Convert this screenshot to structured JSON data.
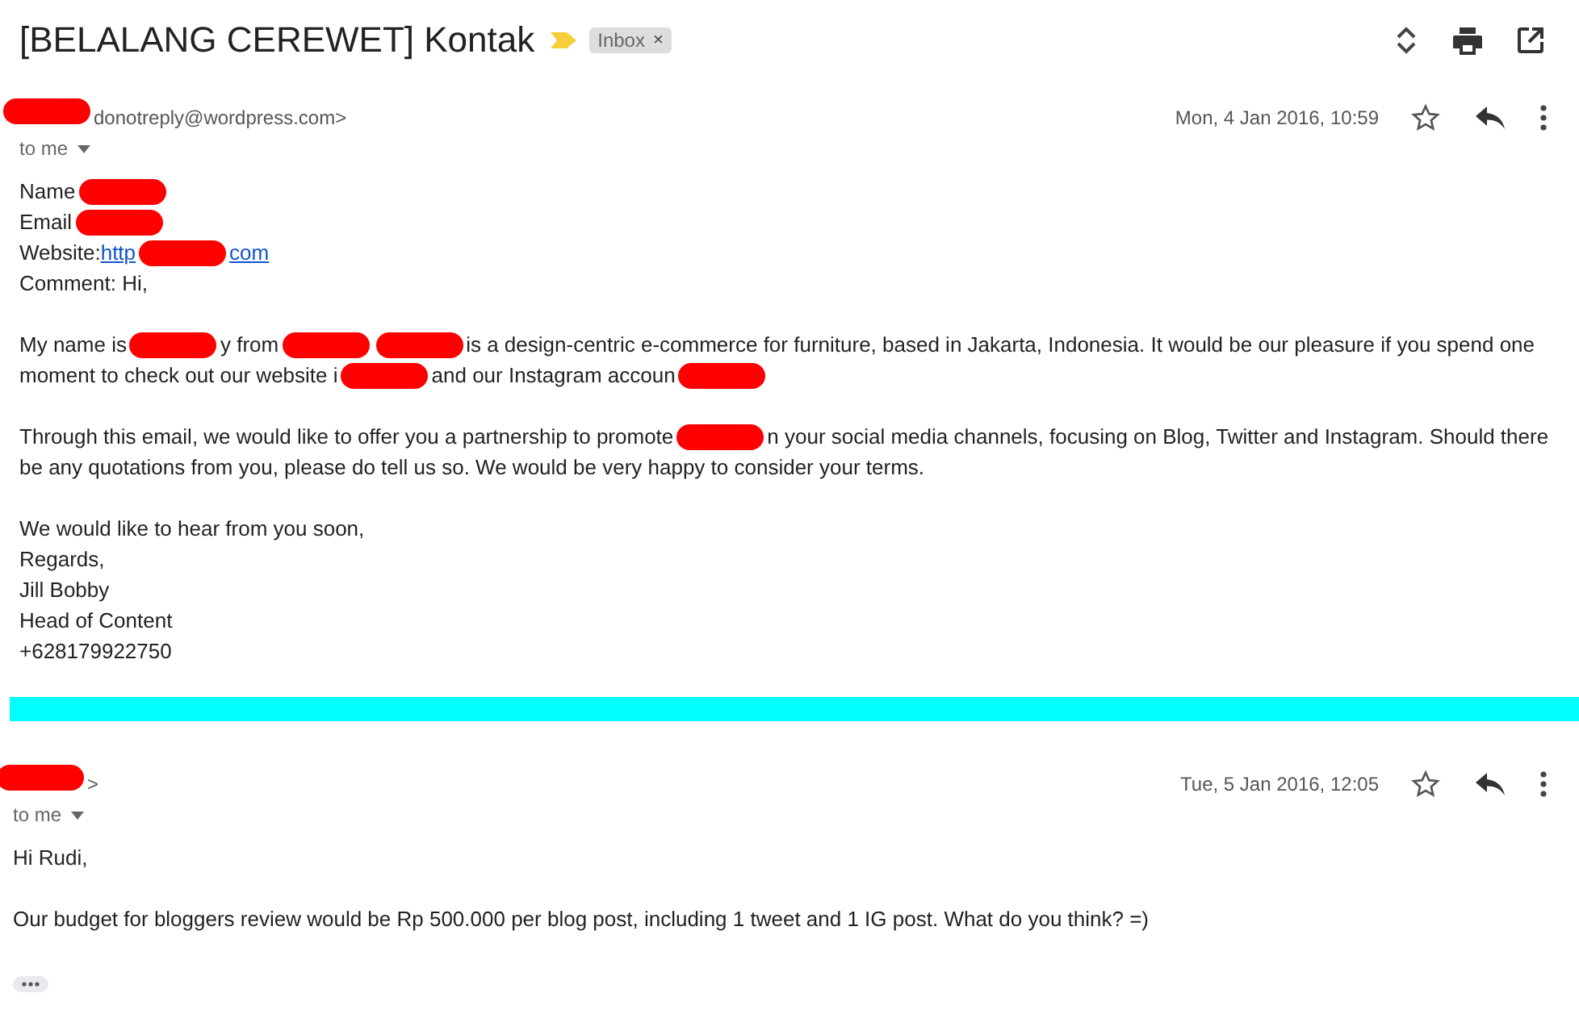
{
  "subject": "[BELALANG CEREWET] Kontak",
  "label": {
    "text": "Inbox",
    "remove": "×"
  },
  "messages": [
    {
      "sender": [
        {
          "kind": "redaction"
        },
        {
          "kind": "text",
          "text": "donotreply@wordpress.com>"
        }
      ],
      "recipient": "to me",
      "date": "Mon, 4 Jan 2016, 10:59",
      "paragraphs": [
        [
          [
            {
              "kind": "text",
              "text": "Name"
            },
            {
              "kind": "redaction"
            }
          ],
          [
            {
              "kind": "text",
              "text": "Email"
            },
            {
              "kind": "redaction"
            }
          ],
          [
            {
              "kind": "text",
              "text": "Website: "
            },
            {
              "kind": "link",
              "text": "http"
            },
            {
              "kind": "redaction"
            },
            {
              "kind": "link",
              "text": "com"
            }
          ],
          [
            {
              "kind": "text",
              "text": "Comment: Hi,"
            }
          ]
        ],
        [
          [
            {
              "kind": "text",
              "text": "My name is"
            },
            {
              "kind": "redaction"
            },
            {
              "kind": "text",
              "text": "y from"
            },
            {
              "kind": "redaction"
            },
            {
              "kind": "redaction"
            },
            {
              "kind": "text",
              "text": "is a design-centric e-commerce for furniture, based in Jakarta, Indonesia. It would be our pleasure if you spend one"
            }
          ],
          [
            {
              "kind": "text",
              "text": "moment to check out our website i"
            },
            {
              "kind": "redaction"
            },
            {
              "kind": "text",
              "text": "and our Instagram accoun"
            },
            {
              "kind": "redaction"
            }
          ]
        ],
        [
          [
            {
              "kind": "text",
              "text": "Through this email, we would like to offer you a partnership to promote"
            },
            {
              "kind": "redaction"
            },
            {
              "kind": "text",
              "text": "n your social media channels, focusing on Blog, Twitter and Instagram. Should there"
            }
          ],
          [
            {
              "kind": "text",
              "text": "be any quotations from you, please do tell us so. We would be very happy to consider your terms."
            }
          ]
        ],
        [
          [
            {
              "kind": "text",
              "text": "We would like to hear from you soon,"
            }
          ],
          [
            {
              "kind": "text",
              "text": "Regards,"
            }
          ],
          [
            {
              "kind": "text",
              "text": "Jill Bobby"
            }
          ],
          [
            {
              "kind": "text",
              "text": "Head of Content"
            }
          ],
          [
            {
              "kind": "text",
              "text": "+628179922750"
            }
          ]
        ]
      ],
      "trimmed": false
    },
    {
      "sender": [
        {
          "kind": "redaction"
        },
        {
          "kind": "text",
          "text": ">"
        }
      ],
      "recipient": "to me",
      "date": "Tue, 5 Jan 2016, 12:05",
      "paragraphs": [
        [
          [
            {
              "kind": "text",
              "text": "Hi Rudi,"
            }
          ]
        ],
        [
          [
            {
              "kind": "text",
              "text": "Our budget for bloggers review would be Rp 500.000 per blog post, including 1 tweet and 1 IG post. What do you think? =)"
            }
          ]
        ]
      ],
      "trimmed": true
    }
  ]
}
